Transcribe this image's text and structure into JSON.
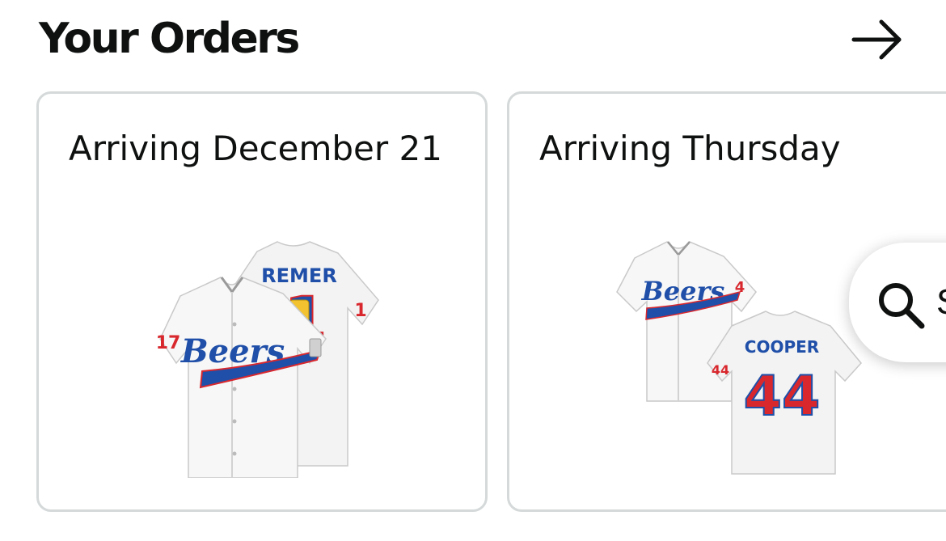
{
  "orders_section": {
    "title": "Your Orders",
    "see_all_icon": "arrow-right-icon"
  },
  "orders": [
    {
      "arrival": "Arriving December 21",
      "product": {
        "team_script": "Beers",
        "back_name": "REMER",
        "back_number": "1",
        "sleeve_number": "17",
        "image_icon": "baseball-jersey-image"
      }
    },
    {
      "arrival": "Arriving Thursday",
      "product": {
        "team_script": "Beers",
        "back_name": "COOPER",
        "back_number": "44",
        "sleeve_number": "44",
        "image_icon": "baseball-jersey-image"
      }
    }
  ],
  "search_button": {
    "icon": "search-icon",
    "label_peek": "S"
  },
  "colors": {
    "text": "#0f1111",
    "card_border": "#d5d9d9",
    "jersey_blue": "#1f4fa8",
    "jersey_red": "#d8282e",
    "jersey_white": "#f3f3f3"
  }
}
